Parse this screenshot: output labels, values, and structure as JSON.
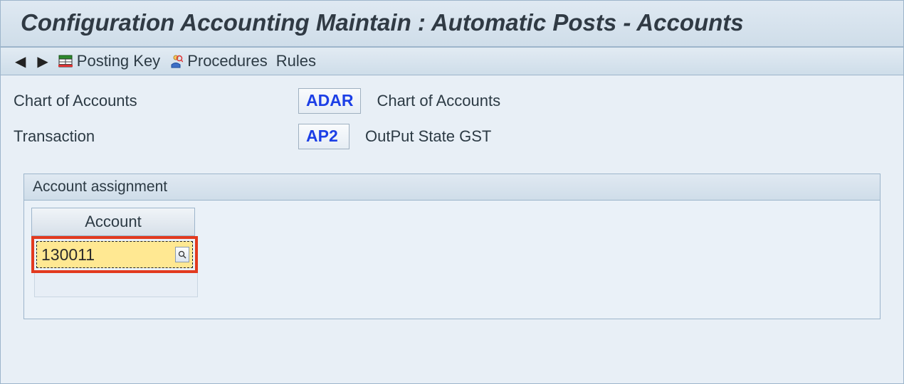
{
  "title": "Configuration Accounting Maintain : Automatic Posts - Accounts",
  "toolbar": {
    "posting_key_label": "Posting Key",
    "procedures_label": "Procedures",
    "rules_label": "Rules"
  },
  "form": {
    "chart_of_accounts_label": "Chart of Accounts",
    "chart_of_accounts_code": "ADAR",
    "chart_of_accounts_desc": "Chart of Accounts",
    "transaction_label": "Transaction",
    "transaction_code": "AP2",
    "transaction_desc": "OutPut State GST"
  },
  "assignment": {
    "panel_title": "Account assignment",
    "column_header": "Account",
    "account_value": "130011"
  }
}
